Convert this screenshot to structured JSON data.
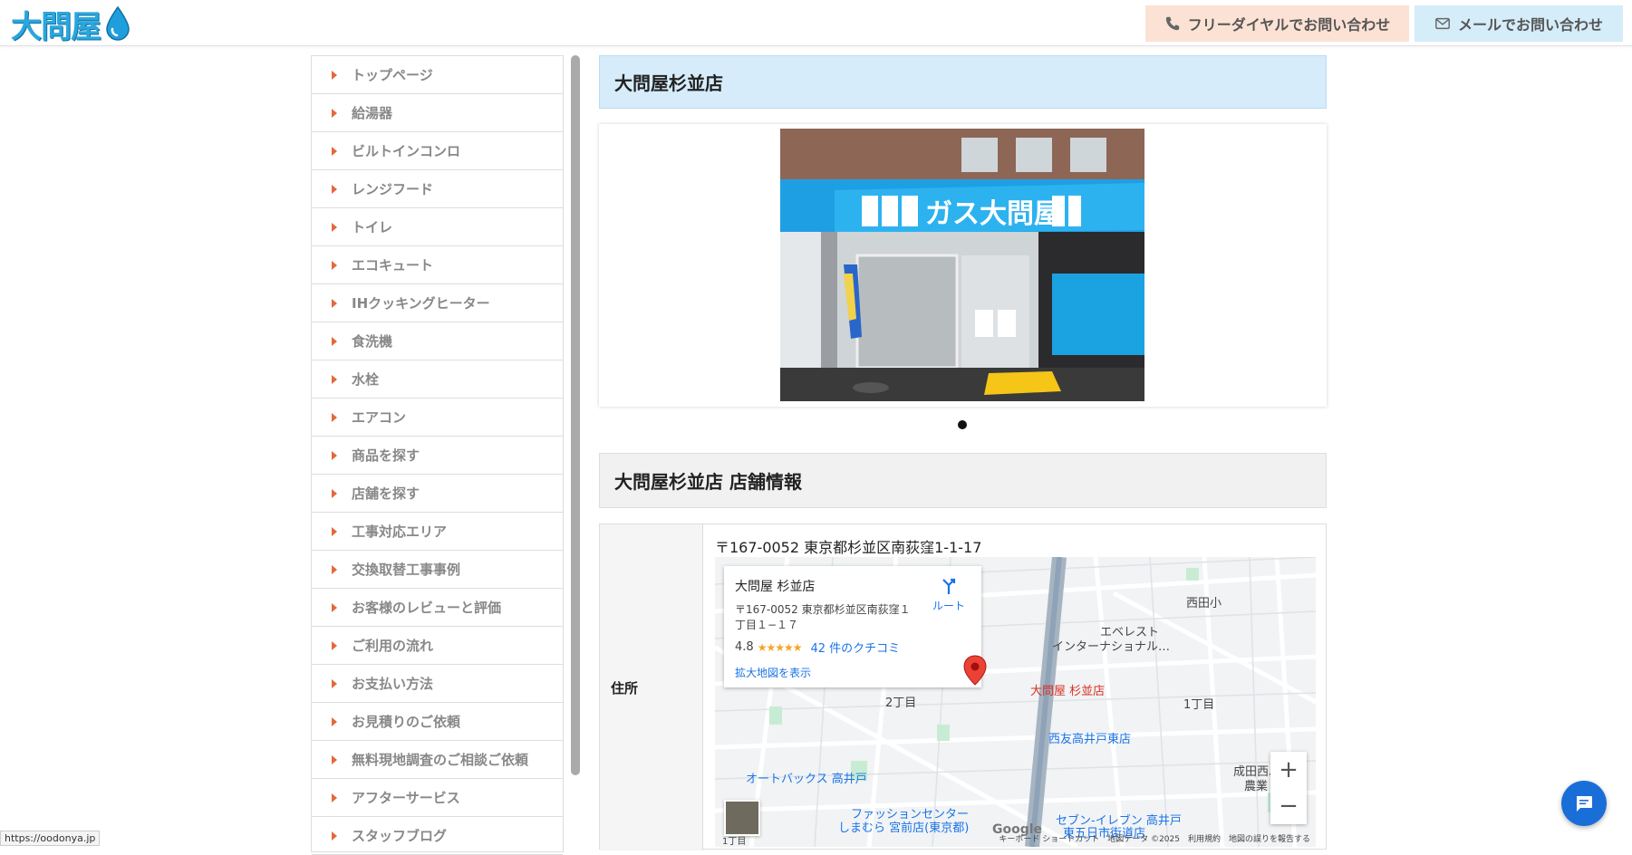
{
  "header": {
    "logo_text": "大問屋",
    "phone_button": "フリーダイヤルでお問い合わせ",
    "mail_button": "メールでお問い合わせ"
  },
  "sidebar": {
    "items": [
      "トップページ",
      "給湯器",
      "ビルトインコンロ",
      "レンジフード",
      "トイレ",
      "エコキュート",
      "IHクッキングヒーター",
      "食洗機",
      "水栓",
      "エアコン",
      "商品を探す",
      "店舗を探す",
      "工事対応エリア",
      "交換取替工事事例",
      "お客様のレビューと評価",
      "ご利用の流れ",
      "お支払い方法",
      "お見積りのご依頼",
      "無料現地調査のご相談ご依頼",
      "アフターサービス",
      "スタッフブログ"
    ]
  },
  "main": {
    "title": "大問屋杉並店",
    "info_title": "大問屋杉並店 店舗情報",
    "photo_sign_text": "ガス大問屋",
    "address_label": "住所",
    "address": "〒167-0052 東京都杉並区南荻窪1-1-17"
  },
  "map": {
    "card_name": "大問屋 杉並店",
    "card_address": "〒167-0052 東京都杉並区南荻窪１丁目１−１７",
    "rating": "4.8",
    "stars": "★★★★★",
    "reviews": "42 件のクチコミ",
    "expand_link": "拡大地図を表示",
    "route_label": "ルート",
    "pin_label": "大問屋 杉並店",
    "labels": {
      "nishitashou": "西田小",
      "everest": "エベレスト",
      "international": "インターナショナル…",
      "chome2": "2丁目",
      "chome1": "1丁目",
      "seiyu": "西友高井戸東店",
      "autobacs": "オートバックス 高井戸",
      "narita": "成田西ふれ",
      "narita2": "農業",
      "fashion1": "ファッションセンター",
      "fashion2": "しまむら 宮前店(東京都)",
      "seven1": "セブン-イレブン 高井戸",
      "seven2": "東五日市街道店",
      "chome1b": "1丁目"
    },
    "google": "Google",
    "footer": "キーボード ショートカット　地図データ ©2025　利用規約　地図の誤りを報告する"
  },
  "status_url": "https://oodonya.jp",
  "colors": {
    "accent_blue": "#2aa7dd",
    "caret": "#e5673c",
    "title_bg": "#d6ecfb",
    "chat": "#1a6ed8"
  }
}
